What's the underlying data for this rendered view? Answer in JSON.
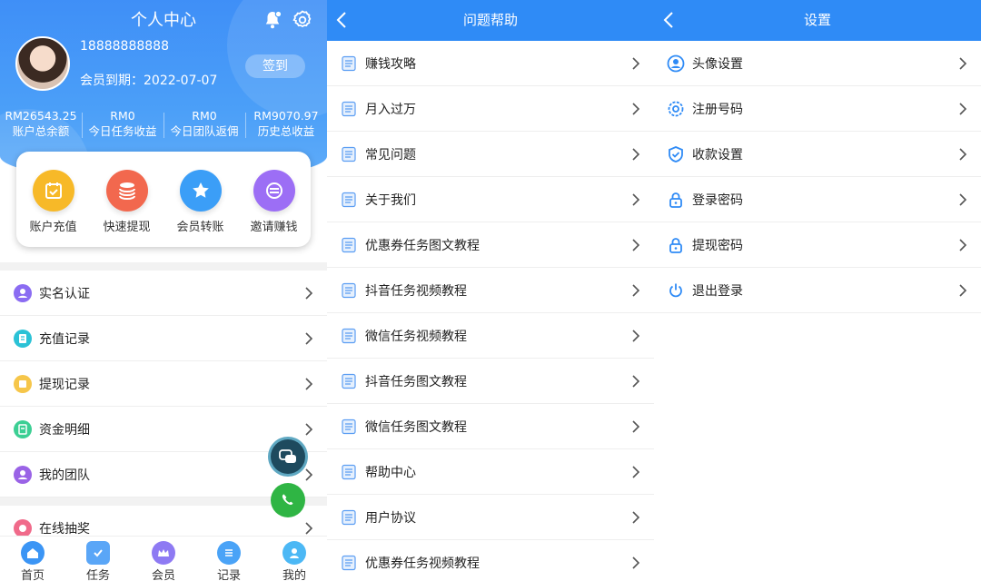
{
  "profile": {
    "title": "个人中心",
    "phone": "18888888888",
    "member_expire": "会员到期：2022-07-07",
    "signin_label": "签到",
    "stats": [
      {
        "value": "RM26543.25",
        "label": "账户总余额"
      },
      {
        "value": "RM0",
        "label": "今日任务收益"
      },
      {
        "value": "RM0",
        "label": "今日团队返佣"
      },
      {
        "value": "RM9070.97",
        "label": "历史总收益"
      }
    ],
    "quick_actions": [
      {
        "label": "账户充值",
        "icon": "calendar-check-icon",
        "color": "#f7b928"
      },
      {
        "label": "快速提现",
        "icon": "coin-stack-icon",
        "color": "#f2684e"
      },
      {
        "label": "会员转账",
        "icon": "star-icon",
        "color": "#3b9ef7"
      },
      {
        "label": "邀请赚钱",
        "icon": "share-icon",
        "color": "#9c6ef5"
      }
    ],
    "menu": [
      {
        "label": "实名认证",
        "icon": "user-icon",
        "color": "#8b6cf2"
      },
      {
        "label": "充值记录",
        "icon": "receipt-icon",
        "color": "#2bc2d6"
      },
      {
        "label": "提现记录",
        "icon": "note-icon",
        "color": "#f6c64a"
      },
      {
        "label": "资金明细",
        "icon": "ledger-icon",
        "color": "#3ccf94"
      },
      {
        "label": "我的团队",
        "icon": "team-icon",
        "color": "#9a63e6"
      }
    ],
    "menu2": [
      {
        "label": "在线抽奖",
        "icon": "lottery-icon",
        "color": "#f06a8a"
      }
    ],
    "tabs": [
      {
        "label": "首页",
        "icon": "home-icon",
        "color": "#3b95f5"
      },
      {
        "label": "任务",
        "icon": "task-icon",
        "color": "#5aa6f7"
      },
      {
        "label": "会员",
        "icon": "crown-icon",
        "color": "#8e7af3"
      },
      {
        "label": "记录",
        "icon": "list-icon",
        "color": "#4aa3f7"
      },
      {
        "label": "我的",
        "icon": "profile-icon",
        "color": "#4cb8f5"
      }
    ],
    "colors": {
      "hero": "#4b9ff8",
      "whatsapp": "#2fb544",
      "chat": "#1e4a5e"
    }
  },
  "help": {
    "title": "问题帮助",
    "items": [
      "赚钱攻略",
      "月入过万",
      "常见问题",
      "关于我们",
      "优惠券任务图文教程",
      "抖音任务视频教程",
      "微信任务视频教程",
      "抖音任务图文教程",
      "微信任务图文教程",
      "帮助中心",
      "用户协议",
      "优惠券任务视频教程"
    ]
  },
  "settings": {
    "title": "设置",
    "items": [
      {
        "label": "头像设置",
        "icon": "avatar-icon"
      },
      {
        "label": "注册号码",
        "icon": "gear-icon"
      },
      {
        "label": "收款设置",
        "icon": "shield-check-icon"
      },
      {
        "label": "登录密码",
        "icon": "lock-icon"
      },
      {
        "label": "提现密码",
        "icon": "lock-icon"
      },
      {
        "label": "退出登录",
        "icon": "power-icon"
      }
    ]
  },
  "accent": "#2f8bf6"
}
